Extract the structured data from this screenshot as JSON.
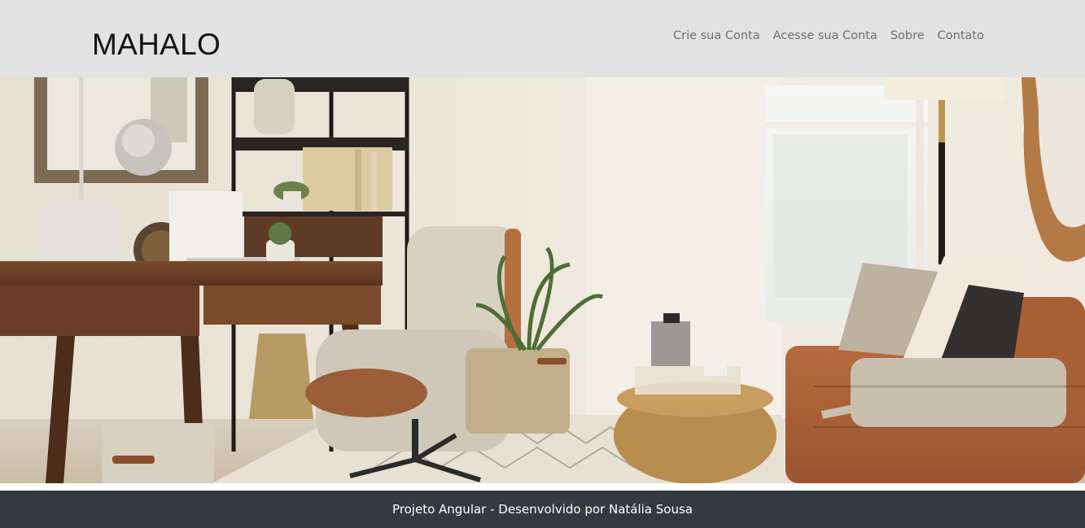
{
  "header": {
    "brand": "MAHALO",
    "nav": [
      {
        "label": "Crie sua Conta"
      },
      {
        "label": "Acesse sua Conta"
      },
      {
        "label": "Sobre"
      },
      {
        "label": "Contato"
      }
    ]
  },
  "hero": {
    "image_subject": "living-room-interior-photo"
  },
  "footer": {
    "text": "Projeto Angular - Desenvolvido por Natália Sousa"
  },
  "colors": {
    "header_bg": "#e2e2e2",
    "nav_text": "#6f6f6f",
    "brand_text": "#121212",
    "footer_bg": "#343a40",
    "footer_text": "#ffffff"
  }
}
